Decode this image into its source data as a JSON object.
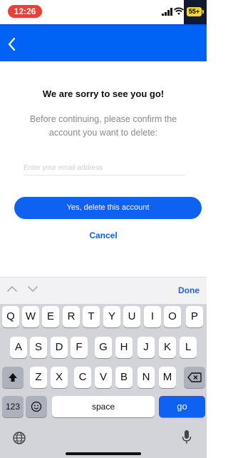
{
  "status_bar": {
    "time": "12:26",
    "battery": "55+"
  },
  "dialog": {
    "title": "We are sorry to see you go!",
    "subtitle": "Before continuing, please confirm the account you want to delete:",
    "email_placeholder": "Enter your email address",
    "confirm_label": "Yes, delete this account",
    "cancel_label": "Cancel"
  },
  "keyboard": {
    "done_label": "Done",
    "row1": [
      "Q",
      "W",
      "E",
      "R",
      "T",
      "Y",
      "U",
      "I",
      "O",
      "P"
    ],
    "row2": [
      "A",
      "S",
      "D",
      "F",
      "G",
      "H",
      "J",
      "K",
      "L"
    ],
    "row3": [
      "Z",
      "X",
      "C",
      "V",
      "B",
      "N",
      "M"
    ],
    "numbers_label": "123",
    "space_label": "space",
    "go_label": "go"
  },
  "colors": {
    "accent": "#0f62f1",
    "header": "#0063f6",
    "time_pill": "#e9413a",
    "battery": "#f2d43b"
  }
}
